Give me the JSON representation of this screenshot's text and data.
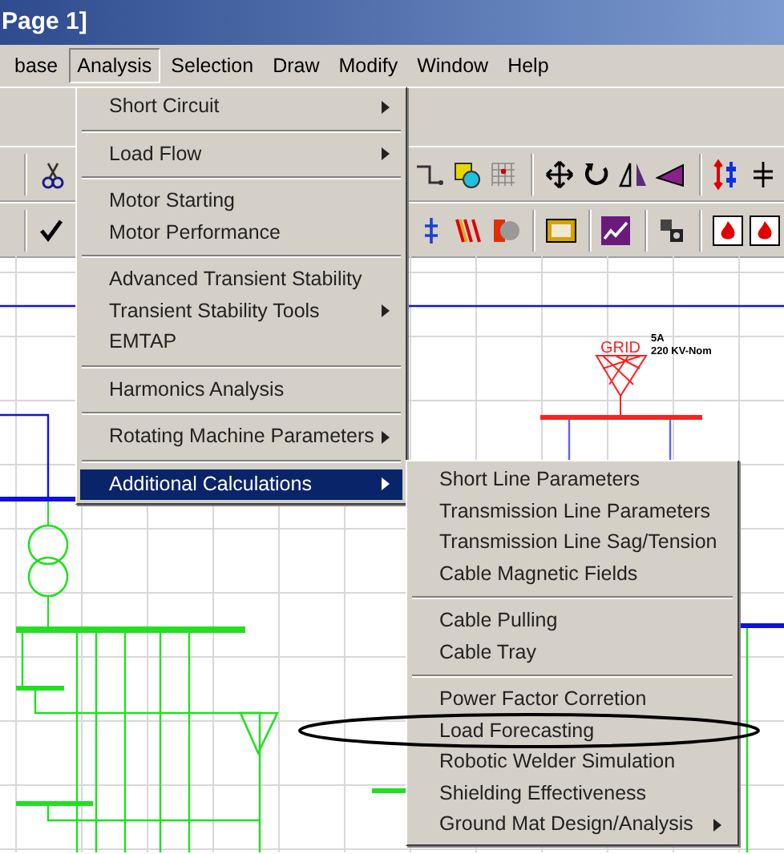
{
  "window": {
    "title": "Page 1]"
  },
  "menu_bar": [
    {
      "label": "base",
      "selected": false
    },
    {
      "label": "Analysis",
      "selected": true
    },
    {
      "label": "Selection",
      "selected": false
    },
    {
      "label": "Draw",
      "selected": false
    },
    {
      "label": "Modify",
      "selected": false
    },
    {
      "label": "Window",
      "selected": false
    },
    {
      "label": "Help",
      "selected": false
    }
  ],
  "analysis_menu": [
    {
      "kind": "item",
      "label": "Short Circuit",
      "submenu": true,
      "selected": false
    },
    {
      "kind": "separator"
    },
    {
      "kind": "item",
      "label": "Load Flow",
      "submenu": true,
      "selected": false
    },
    {
      "kind": "separator"
    },
    {
      "kind": "item",
      "label": "Motor Starting",
      "submenu": false,
      "selected": false
    },
    {
      "kind": "item",
      "label": "Motor Performance",
      "submenu": false,
      "selected": false
    },
    {
      "kind": "separator"
    },
    {
      "kind": "item",
      "label": "Advanced Transient Stability",
      "submenu": false,
      "selected": false
    },
    {
      "kind": "item",
      "label": "Transient Stability Tools",
      "submenu": true,
      "selected": false
    },
    {
      "kind": "item",
      "label": "EMTAP",
      "submenu": false,
      "selected": false
    },
    {
      "kind": "separator"
    },
    {
      "kind": "item",
      "label": "Harmonics Analysis",
      "submenu": false,
      "selected": false
    },
    {
      "kind": "separator"
    },
    {
      "kind": "item",
      "label": "Rotating Machine Parameters",
      "submenu": true,
      "selected": false
    },
    {
      "kind": "separator"
    },
    {
      "kind": "item",
      "label": "Additional Calculations",
      "submenu": true,
      "selected": true
    }
  ],
  "additional_calculations_menu": [
    {
      "kind": "item",
      "label": "Short Line Parameters",
      "submenu": false,
      "selected": false
    },
    {
      "kind": "item",
      "label": "Transmission Line Parameters",
      "submenu": false,
      "selected": false
    },
    {
      "kind": "item",
      "label": "Transmission Line Sag/Tension",
      "submenu": false,
      "selected": false
    },
    {
      "kind": "item",
      "label": "Cable Magnetic Fields",
      "submenu": false,
      "selected": false
    },
    {
      "kind": "separator"
    },
    {
      "kind": "item",
      "label": "Cable Pulling",
      "submenu": false,
      "selected": false
    },
    {
      "kind": "item",
      "label": "Cable Tray",
      "submenu": false,
      "selected": false
    },
    {
      "kind": "separator"
    },
    {
      "kind": "item",
      "label": "Power Factor Corretion",
      "submenu": false,
      "selected": false
    },
    {
      "kind": "item",
      "label": "Load Forecasting",
      "submenu": false,
      "selected": false
    },
    {
      "kind": "item",
      "label": "Robotic Welder Simulation",
      "submenu": false,
      "selected": false
    },
    {
      "kind": "item",
      "label": "Shielding Effectiveness",
      "submenu": false,
      "selected": false
    },
    {
      "kind": "item",
      "label": "Ground Mat Design/Analysis",
      "submenu": true,
      "selected": false
    }
  ],
  "diagram": {
    "grid_label": "GRID",
    "grid_bus_name": "5A",
    "grid_bus_rating": "220 KV-Nom"
  }
}
